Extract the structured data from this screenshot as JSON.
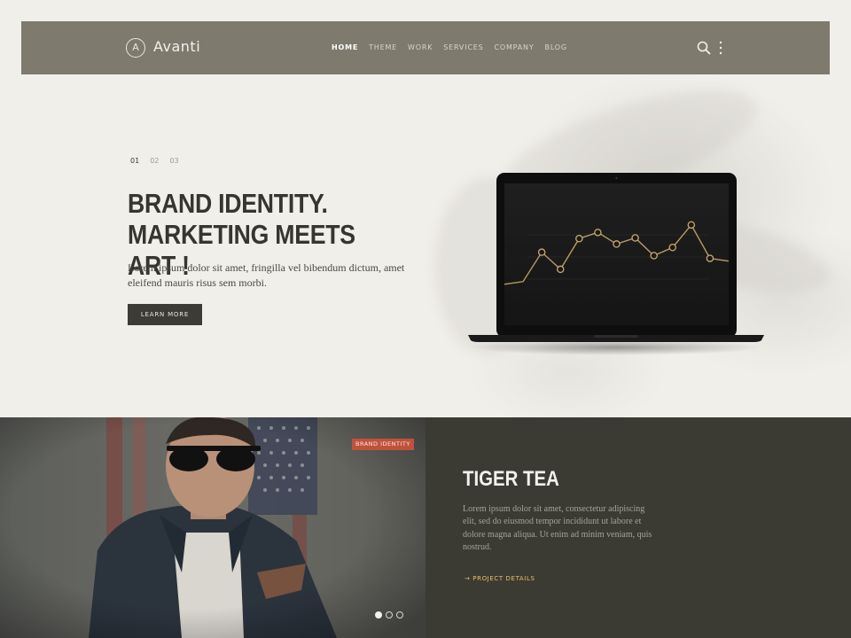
{
  "header": {
    "logo_mark": "A",
    "logo_text": "Avanti",
    "nav": [
      "HOME",
      "THEME",
      "WORK",
      "SERVICES",
      "COMPANY",
      "BLOG"
    ],
    "active_nav": "HOME"
  },
  "hero": {
    "slides": [
      "01",
      "02",
      "03"
    ],
    "active_slide": "01",
    "title": "BRAND IDENTITY. MARKETING MEETS ART !",
    "text": "Lorem ipsum dolor sit amet, fringilla vel bibendum dictum, amet eleifend mauris risus sem morbi.",
    "button_label": "LEARN MORE"
  },
  "laptop_chart": {
    "points": [
      0.08,
      0.12,
      0.55,
      0.3,
      0.75,
      0.84,
      0.67,
      0.76,
      0.5,
      0.62,
      0.95,
      0.46,
      0.42
    ],
    "marker_indices": [
      2,
      3,
      4,
      5,
      6,
      7,
      8,
      9,
      10,
      11
    ]
  },
  "project": {
    "badge": "BRAND IDENTITY",
    "title": "TIGER TEA",
    "text": "Lorem ipsum dolor sit amet, consectetur adipiscing elit, sed do eiusmod tempor incididunt ut labore et dolore magna aliqua. Ut enim ad minim veniam, quis nostrud.",
    "link": "→ PROJECT DETAILS",
    "dots_total": 3,
    "active_dot": 1
  },
  "colors": {
    "header_bg": "#7f7a6e",
    "accent_gold": "#e8c06a",
    "badge_red": "#c0523b",
    "dark_panel": "#3b3a33"
  }
}
